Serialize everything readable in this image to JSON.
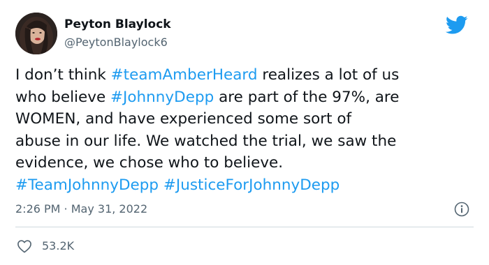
{
  "author": {
    "display_name": "Peyton Blaylock",
    "handle": "@PeytonBlaylock6"
  },
  "body": {
    "line1": {
      "pre": "I don’t think ",
      "hashtag": "#teamAmberHeard",
      "post": " realizes a lot of us"
    },
    "line2": {
      "pre": "who believe ",
      "hashtag": "#JohnnyDepp",
      "post": " are part of the 97%, are"
    },
    "line3": "WOMEN, and have experienced some sort of",
    "line4": "abuse in our life. We watched the trial, we saw the",
    "line5": "evidence, we chose who to believe.",
    "line6": {
      "hashtag1": "#TeamJohnnyDepp",
      "sep": " ",
      "hashtag2": "#JusticeForJohnnyDepp"
    }
  },
  "meta": {
    "time": "2:26 PM",
    "separator": " · ",
    "date": "May 31, 2022"
  },
  "stats": {
    "likes": "53.2K"
  },
  "icons": {
    "brand": "twitter-bird-icon",
    "info": "info-icon",
    "like": "heart-icon"
  },
  "colors": {
    "accent": "#1d9bf0",
    "text": "#0f1419",
    "secondary": "#536471",
    "divider": "#cfd9de"
  }
}
